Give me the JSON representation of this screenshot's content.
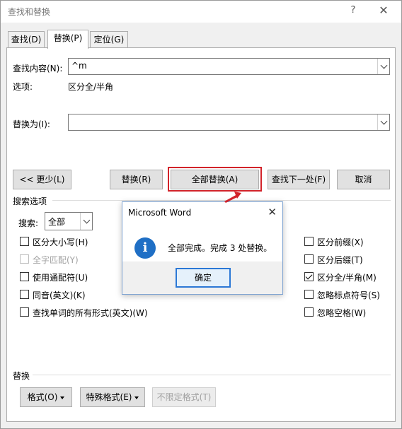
{
  "window": {
    "title": "查找和替换",
    "help_label": "?",
    "close_label": "✕"
  },
  "tabs": [
    {
      "label": "查找(D)"
    },
    {
      "label": "替换(P)"
    },
    {
      "label": "定位(G)"
    }
  ],
  "find": {
    "label": "查找内容(N):",
    "value": "^m",
    "options_label": "选项:",
    "options_value": "区分全/半角"
  },
  "replace": {
    "label": "替换为(I):",
    "value": ""
  },
  "buttons": {
    "less": "<< 更少(L)",
    "replace": "替换(R)",
    "replace_all": "全部替换(A)",
    "find_next": "查找下一处(F)",
    "cancel": "取消"
  },
  "search_options": {
    "section_label": "搜索选项",
    "search_label": "搜索:",
    "search_value": "全部",
    "left": [
      {
        "label": "区分大小写(H)",
        "checked": false,
        "disabled": false
      },
      {
        "label": "全字匹配(Y)",
        "checked": false,
        "disabled": true
      },
      {
        "label": "使用通配符(U)",
        "checked": false,
        "disabled": false
      },
      {
        "label": "同音(英文)(K)",
        "checked": false,
        "disabled": false
      },
      {
        "label": "查找单词的所有形式(英文)(W)",
        "checked": false,
        "disabled": false
      }
    ],
    "right": [
      {
        "label": "区分前缀(X)",
        "checked": false,
        "disabled": false
      },
      {
        "label": "区分后缀(T)",
        "checked": false,
        "disabled": false
      },
      {
        "label": "区分全/半角(M)",
        "checked": true,
        "disabled": false
      },
      {
        "label": "忽略标点符号(S)",
        "checked": false,
        "disabled": false
      },
      {
        "label": "忽略空格(W)",
        "checked": false,
        "disabled": false
      }
    ]
  },
  "replace_section": {
    "label": "替换",
    "format": "格式(O)",
    "special": "特殊格式(E)",
    "no_format": "不限定格式(T)"
  },
  "message": {
    "title": "Microsoft Word",
    "close_label": "✕",
    "icon_glyph": "i",
    "text": "全部完成。完成 3 处替换。",
    "ok": "确定"
  },
  "colors": {
    "highlight": "#d2232a",
    "info_icon": "#1f6fc5",
    "ok_border": "#2b78d6"
  }
}
